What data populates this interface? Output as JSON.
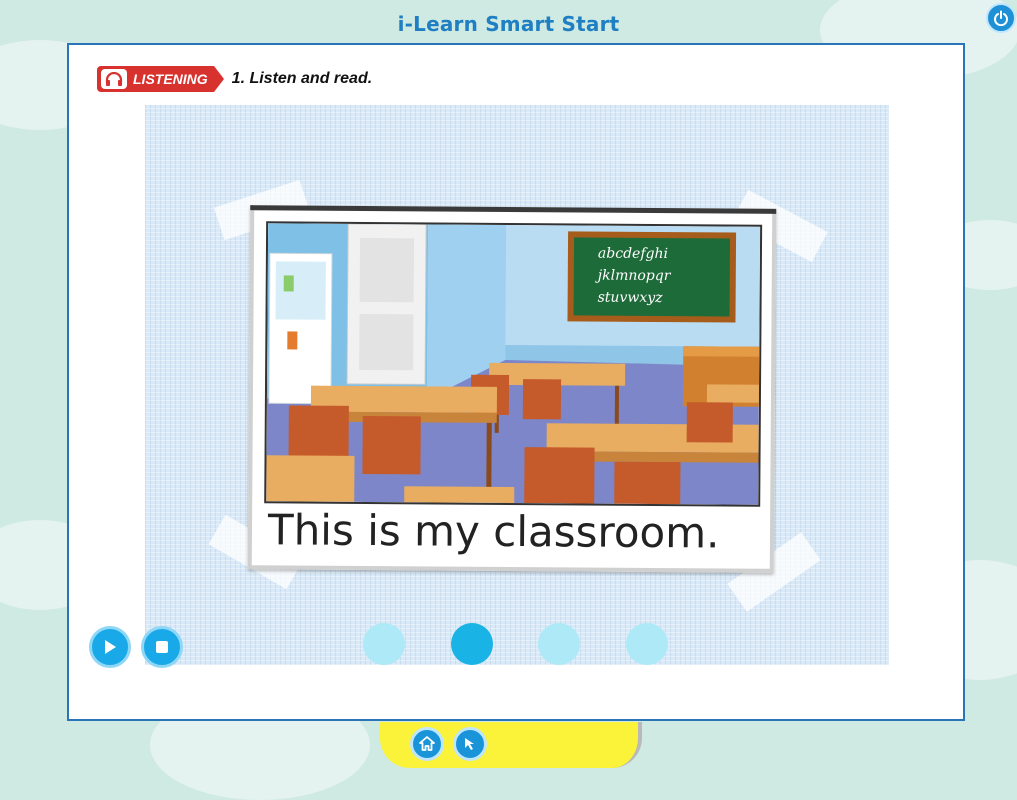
{
  "app": {
    "title": "i-Learn Smart Start"
  },
  "header": {
    "power_icon": "power-icon"
  },
  "instruction": {
    "badge_label": "LISTENING",
    "badge_icon": "headphones-icon",
    "text": "1. Listen and read."
  },
  "scene": {
    "caption": "This is my classroom.",
    "chalkboard_lines": [
      "abcdefghi",
      "jklmnopqr",
      "stuvwxyz"
    ]
  },
  "controls": {
    "play_icon": "play-icon",
    "stop_icon": "stop-icon"
  },
  "pager": {
    "count": 4,
    "active_index": 1
  },
  "bottom_nav": {
    "home_icon": "home-icon",
    "back_icon": "back-icon"
  },
  "colors": {
    "accent": "#1e7fc2",
    "badge": "#d8322e",
    "board": "#1e6b3a",
    "tray": "#fbf23a"
  }
}
